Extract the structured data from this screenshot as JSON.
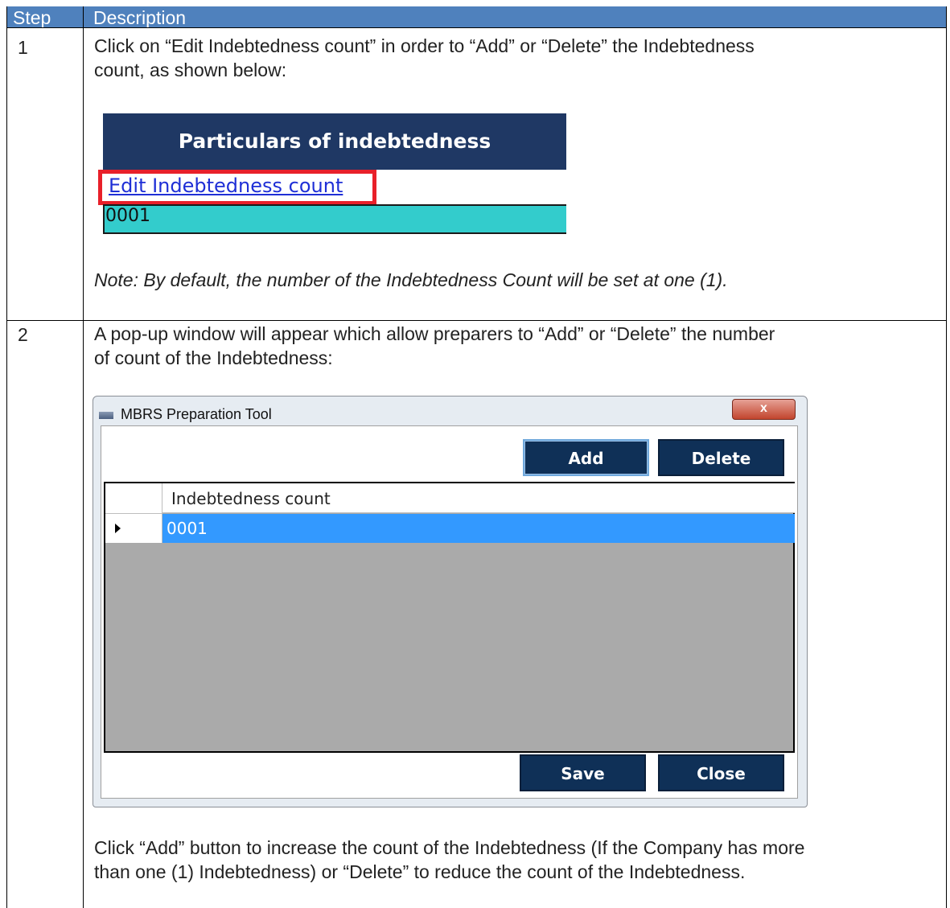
{
  "table": {
    "header": {
      "step": "Step",
      "description": "Description"
    },
    "rows": [
      {
        "step": "1",
        "text_line1": "Click on “Edit Indebtedness count” in order to “Add” or “Delete” the Indebtedness",
        "text_line2": "count, as shown below:",
        "figure": {
          "header": "Particulars of indebtedness",
          "link": "Edit Indebtedness count",
          "value": "0001",
          "colors": {
            "header_bg": "#1f3864",
            "value_bg": "#33cccc",
            "highlight": "#e8202a"
          }
        },
        "note": "Note: By default, the number of the Indebtedness Count will be set at one (1)."
      },
      {
        "step": "2",
        "text_line1": "A pop-up window will appear which allow preparers to “Add” or “Delete” the number",
        "text_line2": "of count of the Indebtedness:",
        "dialog": {
          "title": "MBRS Preparation Tool",
          "close_glyph": "x",
          "add_label": "Add",
          "delete_label": "Delete",
          "column_header": "Indebtedness count",
          "rows": [
            "0001"
          ],
          "save_label": "Save",
          "close_label": "Close",
          "colors": {
            "button_bg": "#0f3057",
            "selection": "#3399ff",
            "empty_area": "#aaaaaa"
          }
        },
        "after_line1": "Click “Add” button to increase the count of the Indebtedness (If the Company has more",
        "after_line2": "than one (1) Indebtedness) or “Delete” to reduce the count of the Indebtedness."
      }
    ],
    "colors": {
      "header_bg": "#4f81bd",
      "header_text": "#ffffff"
    }
  }
}
